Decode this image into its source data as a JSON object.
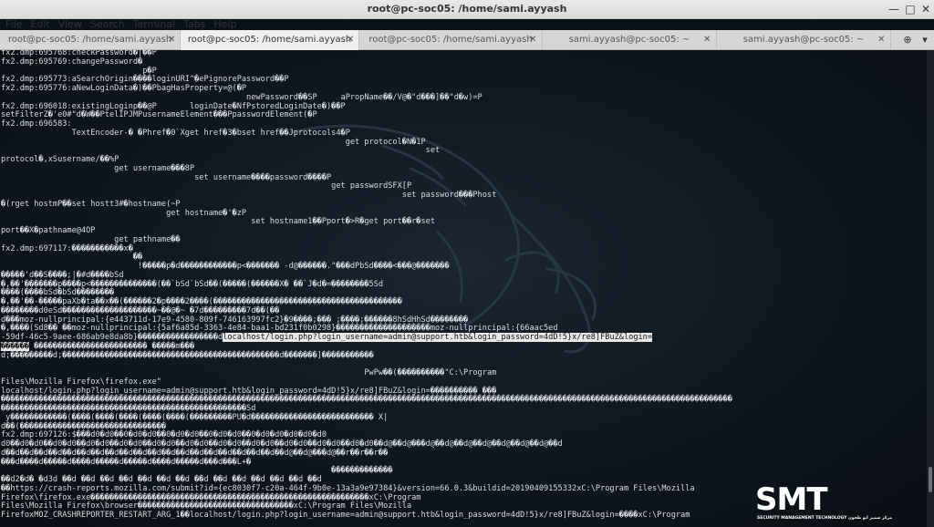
{
  "window": {
    "title": "root@pc-soc05: /home/sami.ayyash",
    "minimize": "—",
    "maximize": "□",
    "close": "✕"
  },
  "menu": [
    "File",
    "Edit",
    "View",
    "Search",
    "Terminal",
    "Tabs",
    "Help"
  ],
  "tabs": [
    {
      "label": "root@pc-soc05: /home/sami.ayyash",
      "close": "✕"
    },
    {
      "label": "root@pc-soc05: /home/sami.ayyash",
      "close": "✕"
    },
    {
      "label": "root@pc-soc05: /home/sami.ayyash",
      "close": "✕"
    },
    {
      "label": "sami.ayyash@pc-soc05: ~",
      "close": "✕"
    },
    {
      "label": "sami.ayyash@pc-soc05: ~",
      "close": "✕"
    }
  ],
  "tab_tools": {
    "new_tab": "⊕",
    "menu": "▾"
  },
  "terminal": {
    "lines": [
      "fx2.dmp:695768:checkPassword�|��P",
      "fx2.dmp:695769:changePassword�",
      "                              p�P",
      "fx2.dmp:695773:aSearchOrigin����loginURI^�ePignorePassword��P",
      "fx2.dmp:695776:aNewLoginData�)��PbagHasProperty=@(�P",
      "                                                    newPassword��SP     aPropName��/V@�\"d���]��\"d�w)=P",
      "fx2.dmp:696018:existingLoginp��@P       loginDate�NfPstoredLoginDate�)��P",
      "setFilterZ�'e0#\"d�W��PtelIPJMPusernameElement���PpasswordElement(�P",
      "fx2.dmp:696583:",
      "               TextEncoder-� �Phref�0`Xget href�3�bset href��Jprotocols4�P",
      "                                                                         get protocol�N�1P",
      "                                                                                          set",
      "protocol�,xSusername/��%P",
      "                        get username���8P",
      "                                         set username����password����P",
      "                                                                      get passwordSFX[P",
      "                                                                                     set password���Phost",
      "�(rget hostmP��set hostt3#�hostname(~P",
      "                                   get hostname�'�zP",
      "                                                     set hostname1��Pport�>R�get port��r�set",
      "port��X�pathname@4OP",
      "                        get pathname��",
      "fx2.dmp:697117:�����������x�",
      "                            ��",
      "                             !�����p�d������������p<������� -d@������.\"���dPbSd����<���@�������",
      "�����'d��S����;|�#d����bSd",
      "�,��'�������p����p<��������������(��`bSd`bSd��(�����(������X� ��`J�d�=��������5Sd",
      "����(����bSd�bSd��������",
      "�,��'��-�����paXb�ta��x��(������2�p����2����(����������������������������������������",
      "��������d0eSd��������������������~��@�~ �7d���������7d��(��",
      "d���moz-nullprincipal:{e443711d-17e9-4580-809f-746163997fc2}�9����;��� ;����;������8hSdHhSd��������",
      "�,����(Sd8�� ��moz-nullprincipal:{5af6a85d-3363-4e84-baa1-bd231f0b0298}��������������������moz-nullprincipal:{66aac5ed",
      "-59df-46c5-9aee-686ab9e8da8b}�������������������������������������������������������������",
      "������ ������������������������ �����m���",
      "d;���������d;����������������������������������������������d�������]�����������",
      "",
      "                                                                             PwPw��(����������\"C:\\Program",
      "Files\\Mozilla Firefox\\firefox.exe\"",
      "localhost/login.php?login_username=admin@support.htb&login_password=4dD!5}x/re8]FBuZ&login=���������� ���",
      "�����������������������������������������������������������������������������������������������������������������������������������������������������������",
      "����������������������������������������������������Sd",
      " y������������(����(����(����(����(����(���������PU�d�������������������������� X|",
      "d��(�������������������������������",
      "fx2.dmp:697126:$���d0�d0��0�d0�d0��0�d0�d0��0�d0�d0��0�d0�d0�d0�d0�d0",
      "d0��d0�d0��d0�d0��d0�d0��d0�d0��d0�d0��d0�d0��d0�d0��d0�d0��d0�d0��d0�d0��d0�d0��d@��d@���d@��d@��d@��d@��d@��d@��d@��d",
      "d��d��d��d��d��d��d��d��d��d��d��d��d��d��d��d��d��d��d��d��d@��d@���d@��r��r��r��",
      "���d����d�����d����d�����d�����d����d�����d���d���L+�",
      "                                                                      �������������",
      "��d2�d� �d3d ��d ��d ��d ��d ��d ��d ��d ��d ��d ��d ��d ��d ��d ��d",
      "��https://crash-reports.mozilla.com/submit?id={ec8030f7-c20a-464f-9b0e-13a3a9e97384}&version=66.0.3&buildid=20190409155332xC:\\Program Files\\Mozilla",
      "Firefox\\firefox.exe�����������������������������������������������������������xC:\\Program",
      "Files\\Mozilla Firefox\\browser���������������������������������xC:\\Program Files\\Mozilla",
      "FirefoxMOZ_CRASHREPORTER_RESTART_ARG_1��localhost/login.php?login_username=admin@support.htb&login_password=4dD!5}x/re8]FBuZ&login=����xC:\\Program"
    ],
    "selected_line_index": 32,
    "selected_text": "localhost/login.php?login_username=admin@support.htb&login_password=4dD!5}x/re8]FBuZ&login=",
    "selected_prefix": "-59df-46c5-9aee-686ab9e8da8b}�����������������d",
    "selected_line_next": "������"
  },
  "watermark": {
    "logo": "SMT",
    "subtitle": "SECURITY MANAGEMENT TECHNOLOGY مركز سمير ابو طحون"
  },
  "colors": {
    "terminal_text": "#d8dde2",
    "terminal_bg": "#0b1118",
    "selection_bg": "#e8e8e8"
  }
}
